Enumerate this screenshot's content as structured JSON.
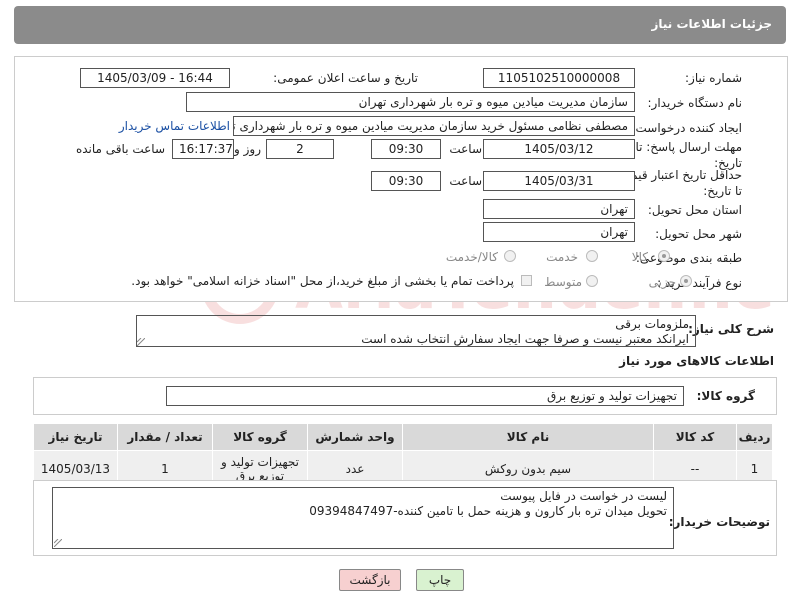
{
  "header": {
    "title": "جزئیات اطلاعات نیاز"
  },
  "form": {
    "need_number_label": "شماره نیاز:",
    "need_number": "1105102510000008",
    "announce_label": "تاریخ و ساعت اعلان عمومی:",
    "announce_value": "1405/03/09 - 16:44",
    "buyer_org_label": "نام دستگاه خریدار:",
    "buyer_org": "سازمان مدیریت میادین میوه و تره بار شهرداری تهران",
    "creator_label": "ایجاد کننده درخواست:",
    "creator": "مصطفی نظامی مسئول خرید سازمان مدیریت میادین میوه و تره بار شهرداری تهران",
    "contact_link": "اطلاعات تماس خریدار",
    "deadline_label": "مهلت ارسال پاسخ: تا تاریخ:",
    "deadline_date": "1405/03/12",
    "time_label": "ساعت",
    "deadline_time": "09:30",
    "days_value": "2",
    "days_label": "روز و",
    "remaining_time": "16:17:37",
    "remaining_label": "ساعت باقی مانده",
    "price_validity_label": "حداقل تاریخ اعتبار قیمت: تا تاریخ:",
    "price_date": "1405/03/31",
    "price_time": "09:30",
    "province_label": "استان محل تحویل:",
    "province": "تهران",
    "city_label": "شهر محل تحویل:",
    "city": "تهران",
    "category_label": "طبقه بندی موضوعی:",
    "cat_goods": "کالا",
    "cat_service": "خدمت",
    "cat_goods_service": "کالا/خدمت",
    "process_label": "نوع فرآیند خرید :",
    "proc_minor": "جزیی",
    "proc_medium": "متوسط",
    "payment_note": "پرداخت تمام یا بخشی از مبلغ خرید،از محل \"اسناد خزانه اسلامی\" خواهد بود."
  },
  "description": {
    "label": "شرح کلی نیاز:",
    "line1": "ملزومات برقی",
    "line2": "ایرانکد معتبر نیست و صرفا جهت ایجاد سفارش انتخاب شده است"
  },
  "goods_info": {
    "title": "اطلاعات کالاهای مورد نیاز",
    "group_label": "گروه کالا:",
    "group_value": "تجهیزات تولید و توزیع برق"
  },
  "table": {
    "headers": [
      "ردیف",
      "کد کالا",
      "نام کالا",
      "واحد شمارش",
      "گروه کالا",
      "تعداد / مقدار",
      "تاریخ نیاز"
    ],
    "rows": [
      [
        "1",
        "--",
        "سیم بدون روکش",
        "عدد",
        "تجهیزات تولید و توزیع برق",
        "1",
        "1405/03/13"
      ]
    ]
  },
  "buyer_notes": {
    "label": "توضیحات خریدار:",
    "line1": "لیست در خواست در فایل پیوست",
    "line2": "تحویل میدان تره بار کارون و هزینه حمل با تامین کننده-09394847497"
  },
  "buttons": {
    "print": "چاپ",
    "back": "بازگشت"
  },
  "colors": {
    "header_bg": "#8b8b8b",
    "print_bg": "#d9f2d0",
    "back_bg": "#f7d0d0"
  }
}
